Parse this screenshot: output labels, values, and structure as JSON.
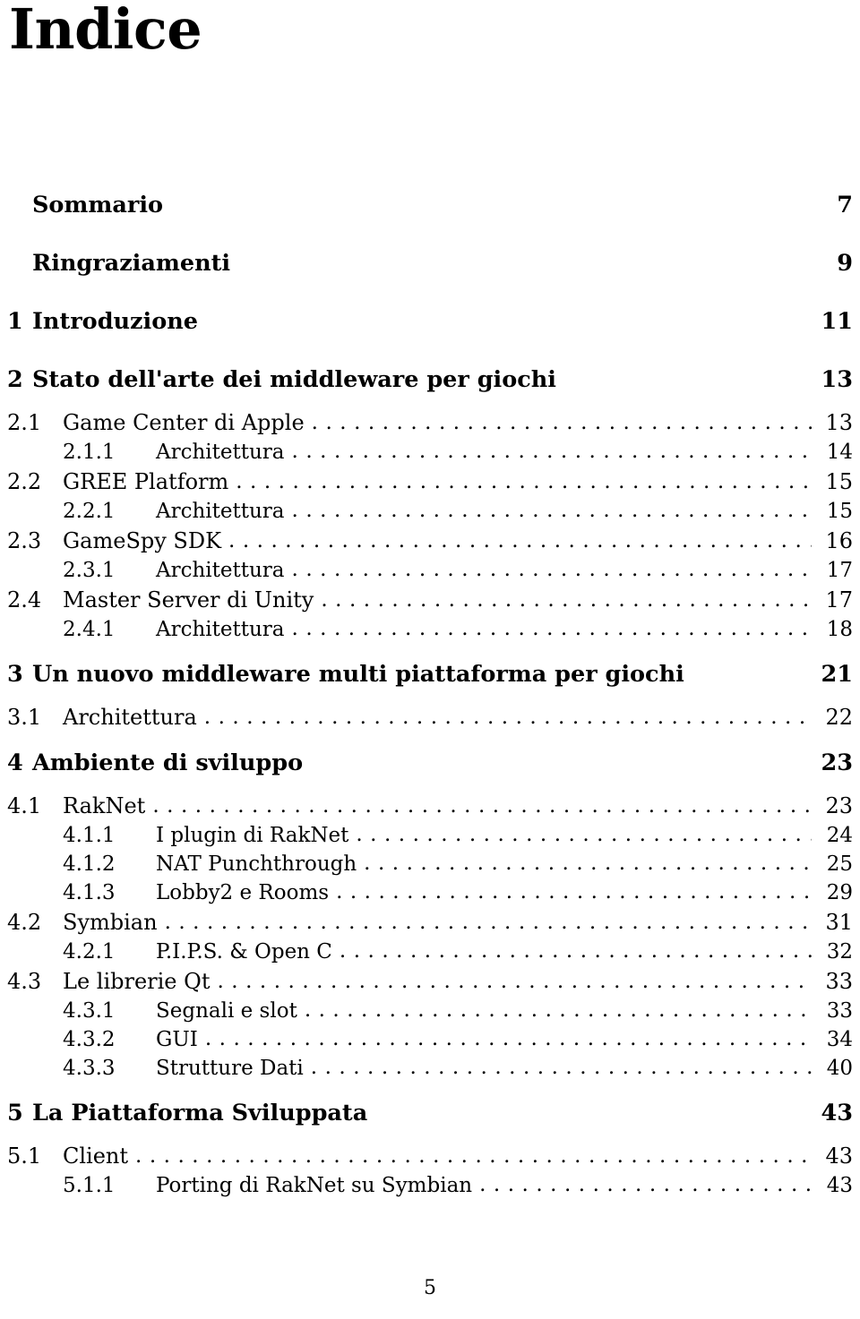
{
  "document": {
    "title": "Indice",
    "page_footer": "5"
  },
  "entries": [
    {
      "level": 0,
      "num": "",
      "label": "Sommario",
      "page": "7",
      "leader": false
    },
    {
      "level": 0,
      "num": "",
      "label": "Ringraziamenti",
      "page": "9",
      "leader": false
    },
    {
      "level": 0,
      "num": "1",
      "label": "Introduzione",
      "page": "11",
      "leader": false
    },
    {
      "level": 0,
      "num": "2",
      "label": "Stato dell'arte dei middleware per giochi",
      "page": "13",
      "leader": false
    },
    {
      "level": 1,
      "num": "2.1",
      "label": "Game Center di Apple",
      "page": "13",
      "leader": true
    },
    {
      "level": 2,
      "num": "2.1.1",
      "label": "Architettura",
      "page": "14",
      "leader": true
    },
    {
      "level": 1,
      "num": "2.2",
      "label": "GREE Platform",
      "page": "15",
      "leader": true
    },
    {
      "level": 2,
      "num": "2.2.1",
      "label": "Architettura",
      "page": "15",
      "leader": true
    },
    {
      "level": 1,
      "num": "2.3",
      "label": "GameSpy SDK",
      "page": "16",
      "leader": true
    },
    {
      "level": 2,
      "num": "2.3.1",
      "label": "Architettura",
      "page": "17",
      "leader": true
    },
    {
      "level": 1,
      "num": "2.4",
      "label": "Master Server di Unity",
      "page": "17",
      "leader": true
    },
    {
      "level": 2,
      "num": "2.4.1",
      "label": "Architettura",
      "page": "18",
      "leader": true
    },
    {
      "level": 0,
      "num": "3",
      "label": "Un nuovo middleware multi piattaforma per giochi",
      "page": "21",
      "leader": false
    },
    {
      "level": 1,
      "num": "3.1",
      "label": "Architettura",
      "page": "22",
      "leader": true
    },
    {
      "level": 0,
      "num": "4",
      "label": "Ambiente di sviluppo",
      "page": "23",
      "leader": false
    },
    {
      "level": 1,
      "num": "4.1",
      "label": "RakNet",
      "page": "23",
      "leader": true
    },
    {
      "level": 2,
      "num": "4.1.1",
      "label": "I plugin di RakNet",
      "page": "24",
      "leader": true
    },
    {
      "level": 2,
      "num": "4.1.2",
      "label": "NAT Punchthrough",
      "page": "25",
      "leader": true
    },
    {
      "level": 2,
      "num": "4.1.3",
      "label": "Lobby2 e Rooms",
      "page": "29",
      "leader": true
    },
    {
      "level": 1,
      "num": "4.2",
      "label": "Symbian",
      "page": "31",
      "leader": true
    },
    {
      "level": 2,
      "num": "4.2.1",
      "label": "P.I.P.S. & Open C",
      "page": "32",
      "leader": true
    },
    {
      "level": 1,
      "num": "4.3",
      "label": "Le librerie Qt",
      "page": "33",
      "leader": true
    },
    {
      "level": 2,
      "num": "4.3.1",
      "label": "Segnali e slot",
      "page": "33",
      "leader": true
    },
    {
      "level": 2,
      "num": "4.3.2",
      "label": "GUI",
      "page": "34",
      "leader": true
    },
    {
      "level": 2,
      "num": "4.3.3",
      "label": "Strutture Dati",
      "page": "40",
      "leader": true
    },
    {
      "level": 0,
      "num": "5",
      "label": "La Piattaforma Sviluppata",
      "page": "43",
      "leader": false
    },
    {
      "level": 1,
      "num": "5.1",
      "label": "Client",
      "page": "43",
      "leader": true
    },
    {
      "level": 2,
      "num": "5.1.1",
      "label": "Porting di RakNet su Symbian",
      "page": "43",
      "leader": true
    }
  ]
}
